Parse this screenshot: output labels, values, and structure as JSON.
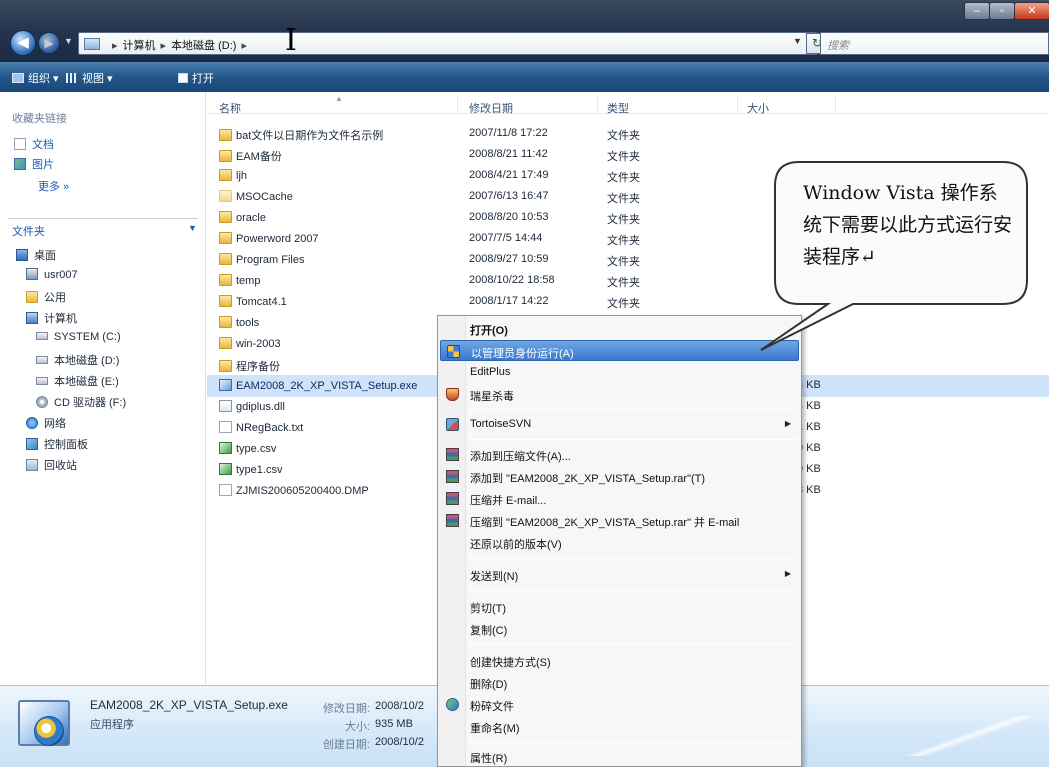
{
  "address": {
    "crumbs": [
      "计算机",
      "本地磁盘 (D:)"
    ],
    "search_placeholder": "搜索"
  },
  "window_controls": {
    "minimize": "–",
    "maximize": "▫",
    "close": "✕"
  },
  "commandbar": {
    "organize": "组织 ▾",
    "views": "视图 ▾",
    "open": "打开"
  },
  "nav": {
    "favorites_head": "收藏夹链接",
    "favorites": [
      "文档",
      "图片"
    ],
    "more": "更多 »",
    "folders_head": "文件夹",
    "tree": [
      {
        "label": "桌面",
        "icon": "desktop-icon"
      },
      {
        "label": "usr007",
        "icon": "user-icon"
      },
      {
        "label": "公用",
        "icon": "folder-icon"
      },
      {
        "label": "计算机",
        "icon": "computer-icon"
      },
      {
        "label": "SYSTEM (C:)",
        "icon": "drive-icon"
      },
      {
        "label": "本地磁盘 (D:)",
        "icon": "drive-icon"
      },
      {
        "label": "本地磁盘 (E:)",
        "icon": "drive-icon"
      },
      {
        "label": "CD 驱动器 (F:)",
        "icon": "cd-drive-icon"
      },
      {
        "label": "网络",
        "icon": "network-icon"
      },
      {
        "label": "控制面板",
        "icon": "control-panel-icon"
      },
      {
        "label": "回收站",
        "icon": "recycle-bin-icon"
      }
    ]
  },
  "columns": {
    "name": "名称",
    "date": "修改日期",
    "type": "类型",
    "size": "大小"
  },
  "files": [
    {
      "name": "bat文件以日期作为文件名示例",
      "date": "2007/11/8 17:22",
      "type": "文件夹",
      "size": "",
      "icon": "folder-icon"
    },
    {
      "name": "EAM备份",
      "date": "2008/8/21 11:42",
      "type": "文件夹",
      "size": "",
      "icon": "folder-icon"
    },
    {
      "name": "ljh",
      "date": "2008/4/21 17:49",
      "type": "文件夹",
      "size": "",
      "icon": "folder-icon"
    },
    {
      "name": "MSOCache",
      "date": "2007/6/13 16:47",
      "type": "文件夹",
      "size": "",
      "icon": "folder-icon"
    },
    {
      "name": "oracle",
      "date": "2008/8/20 10:53",
      "type": "文件夹",
      "size": "",
      "icon": "folder-icon"
    },
    {
      "name": "Powerword 2007",
      "date": "2007/7/5 14:44",
      "type": "文件夹",
      "size": "",
      "icon": "folder-icon"
    },
    {
      "name": "Program Files",
      "date": "2008/9/27 10:59",
      "type": "文件夹",
      "size": "",
      "icon": "folder-icon"
    },
    {
      "name": "temp",
      "date": "2008/10/22 18:58",
      "type": "文件夹",
      "size": "",
      "icon": "folder-icon"
    },
    {
      "name": "Tomcat4.1",
      "date": "2008/1/17 14:22",
      "type": "文件夹",
      "size": "",
      "icon": "folder-icon"
    },
    {
      "name": "tools",
      "date": "",
      "type": "",
      "size": "",
      "icon": "folder-icon"
    },
    {
      "name": "win-2003",
      "date": "",
      "type": "",
      "size": "",
      "icon": "folder-icon"
    },
    {
      "name": "程序备份",
      "date": "",
      "type": "",
      "size": "",
      "icon": "folder-icon"
    },
    {
      "name": "EAM2008_2K_XP_VISTA_Setup.exe",
      "date": "",
      "type": "",
      "size": "4 KB",
      "icon": "exe-icon"
    },
    {
      "name": "gdiplus.dll",
      "date": "",
      "type": "",
      "size": "4 KB",
      "icon": "dll-icon"
    },
    {
      "name": "NRegBack.txt",
      "date": "",
      "type": "",
      "size": "1 KB",
      "icon": "txt-icon"
    },
    {
      "name": "type.csv",
      "date": "",
      "type": "",
      "size": "9 KB",
      "icon": "csv-icon"
    },
    {
      "name": "type1.csv",
      "date": "",
      "type": "",
      "size": "9 KB",
      "icon": "csv-icon"
    },
    {
      "name": "ZJMIS200605200400.DMP",
      "date": "",
      "type": "",
      "size": "3 KB",
      "icon": "dmp-icon"
    }
  ],
  "context_menu": {
    "open": "打开(O)",
    "run_as_admin": "以管理员身份运行(A)",
    "editplus": "EditPlus",
    "antivirus": "瑞星杀毒",
    "tortoise": "TortoiseSVN",
    "add_archive": "添加到压缩文件(A)...",
    "add_rar": "添加到 \"EAM2008_2K_XP_VISTA_Setup.rar\"(T)",
    "compress_email": "压缩并 E-mail...",
    "compress_rar_email": "压缩到 \"EAM2008_2K_XP_VISTA_Setup.rar\" 并 E-mail",
    "restore_prev": "还原以前的版本(V)",
    "send_to": "发送到(N)",
    "cut": "剪切(T)",
    "copy": "复制(C)",
    "create_shortcut": "创建快捷方式(S)",
    "delete": "删除(D)",
    "shred": "粉碎文件",
    "rename": "重命名(M)",
    "properties": "属性(R)"
  },
  "callout": {
    "text": "Window  Vista 操作系统下需要以此方式运行安装程序↵"
  },
  "details": {
    "name": "EAM2008_2K_XP_VISTA_Setup.exe",
    "type": "应用程序",
    "modified_label": "修改日期:",
    "modified_value": "2008/10/2",
    "size_label": "大小:",
    "size_value": "935 MB",
    "created_label": "创建日期:",
    "created_value": "2008/10/2"
  }
}
